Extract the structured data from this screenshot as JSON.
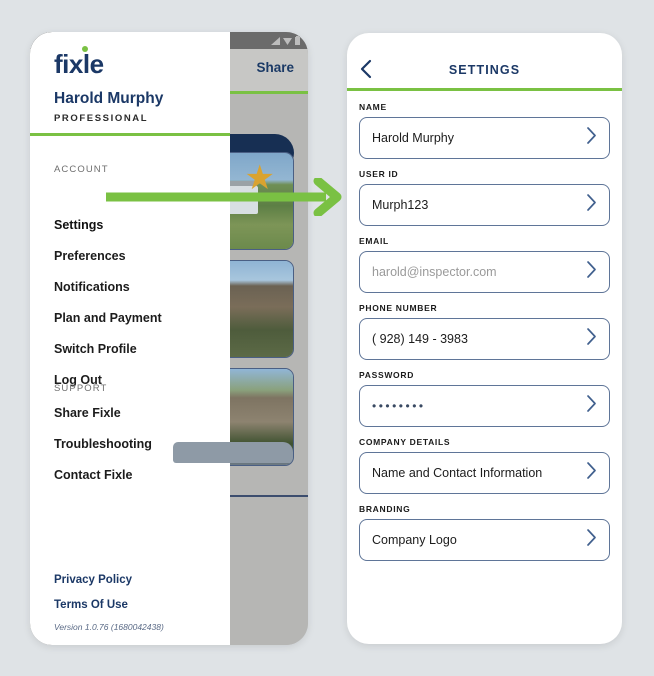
{
  "colors": {
    "page_background": "#dfe3e6",
    "brand_navy": "#1b3866",
    "brand_green": "#7ac143",
    "arrow_green": "#7ac143",
    "field_border": "#5f7598",
    "placeholder_gray": "#9a9a9a"
  },
  "left_panel": {
    "brand": {
      "name": "fixle",
      "dot_icon": "green-dot-icon"
    },
    "user": {
      "name": "Harold Murphy",
      "role": "PROFESSIONAL"
    },
    "sections": [
      {
        "label": "ACCOUNT",
        "items": [
          {
            "label": "Settings",
            "active": true
          },
          {
            "label": "Preferences",
            "active": false
          },
          {
            "label": "Notifications",
            "active": false
          },
          {
            "label": "Plan and Payment",
            "active": false
          },
          {
            "label": "Switch Profile",
            "active": false
          },
          {
            "label": "Log Out",
            "active": false
          }
        ]
      },
      {
        "label": "SUPPORT",
        "items": [
          {
            "label": "Share Fixle",
            "active": false
          },
          {
            "label": "Troubleshooting",
            "active": false
          },
          {
            "label": "Contact Fixle",
            "active": false
          }
        ]
      }
    ],
    "legal": {
      "privacy_policy": "Privacy Policy",
      "terms_of_use": "Terms Of Use",
      "version": "Version 1.0.76 (1680042438)"
    },
    "background_app": {
      "share_label": "Share",
      "status_icons": [
        "signal-icon",
        "wifi-icon",
        "battery-icon"
      ],
      "cards": [
        {
          "badge_icon": "star-icon"
        },
        {
          "badge_icon": ""
        },
        {
          "badge_icon": ""
        }
      ]
    }
  },
  "annotation": {
    "arrow_icon": "right-arrow-annotation",
    "color": "#7ac143"
  },
  "right_panel": {
    "header": {
      "back_icon": "chevron-left-icon",
      "title": "SETTINGS"
    },
    "fields": [
      {
        "label": "NAME",
        "value": "Harold Murphy",
        "is_placeholder": false,
        "is_masked": false,
        "chevron_icon": "chevron-right-icon"
      },
      {
        "label": "USER ID",
        "value": "Murph123",
        "is_placeholder": false,
        "is_masked": false,
        "chevron_icon": "chevron-right-icon"
      },
      {
        "label": "EMAIL",
        "value": "harold@inspector.com",
        "is_placeholder": true,
        "is_masked": false,
        "chevron_icon": "chevron-right-icon"
      },
      {
        "label": "PHONE NUMBER",
        "value": "( 928) 149 - 3983",
        "is_placeholder": false,
        "is_masked": false,
        "chevron_icon": "chevron-right-icon"
      },
      {
        "label": "PASSWORD",
        "value": "••••••••",
        "is_placeholder": false,
        "is_masked": true,
        "chevron_icon": "chevron-right-icon"
      },
      {
        "label": "COMPANY DETAILS",
        "value": "Name and Contact Information",
        "is_placeholder": false,
        "is_masked": false,
        "chevron_icon": "chevron-right-icon"
      },
      {
        "label": "BRANDING",
        "value": "Company Logo",
        "is_placeholder": false,
        "is_masked": false,
        "chevron_icon": "chevron-right-icon"
      }
    ]
  }
}
